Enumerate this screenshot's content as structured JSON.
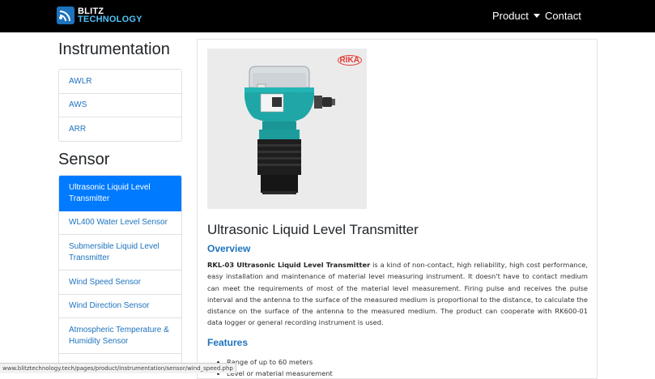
{
  "navbar": {
    "logo_line1": "BLITZ",
    "logo_line2": "TECHNOLOGY",
    "product_label": "Product",
    "contact_label": "Contact"
  },
  "sidebar": {
    "instrumentation_heading": "Instrumentation",
    "instrumentation_items": [
      {
        "label": "AWLR"
      },
      {
        "label": "AWS"
      },
      {
        "label": "ARR"
      }
    ],
    "sensor_heading": "Sensor",
    "sensor_items": [
      {
        "label": "Ultrasonic Liquid Level Transmitter",
        "active": true
      },
      {
        "label": "WL400 Water Level Sensor"
      },
      {
        "label": "Submersible Liquid Level Transmitter"
      },
      {
        "label": "Wind Speed Sensor"
      },
      {
        "label": "Wind Direction Sensor"
      },
      {
        "label": "Atmospheric Temperature & Humidity Sensor"
      },
      {
        "label": "..."
      }
    ]
  },
  "product": {
    "image_brand": "RIKA",
    "title": "Ultrasonic Liquid Level Transmitter",
    "overview_heading": "Overview",
    "overview_bold": "RKL-03 Ultrasonic Liquid Level Transmitter",
    "overview_text": " is a kind of non-contact, high reliability, high cost performance, easy installation and maintenance of material level measuring instrument. It doesn't have to contact medium can meet the requirements of most of the material level measurement. Firing pulse and receives the pulse interval and the antenna to the surface of the measured medium is proportional to the distance, to calculate the distance on the surface of the antenna to the measured medium. The product can cooperate with RK600-01 data logger or general recording instrument is used.",
    "features_heading": "Features",
    "features": [
      "Range of up to 60 meters",
      "Level or material measurement"
    ]
  },
  "status_url": "www.blitztechnology.tech/pages/product/instrumentation/sensor/wind_speed.php"
}
